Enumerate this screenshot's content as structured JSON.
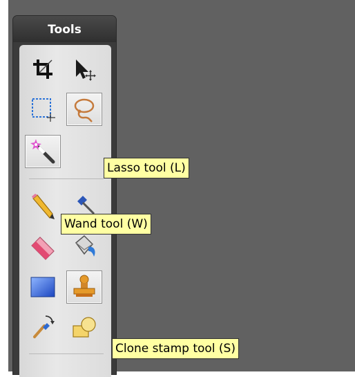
{
  "panel": {
    "title": "Tools"
  },
  "tooltips": {
    "lasso": "Lasso tool (L)",
    "wand": "Wand tool (W)",
    "clone": "Clone stamp tool (S)"
  },
  "icons": [
    "crop-icon",
    "move-selection-icon",
    "rectangle-select-icon",
    "lasso-icon",
    "magic-wand-icon",
    "pencil-icon",
    "brush-icon",
    "eraser-icon",
    "paint-bucket-icon",
    "gradient-icon",
    "clone-stamp-icon",
    "recolor-icon",
    "shapes-icon"
  ],
  "colors": {
    "canvas": "#616161",
    "panel": "#3b3b3b",
    "tooltip_bg": "#ffffa3"
  }
}
